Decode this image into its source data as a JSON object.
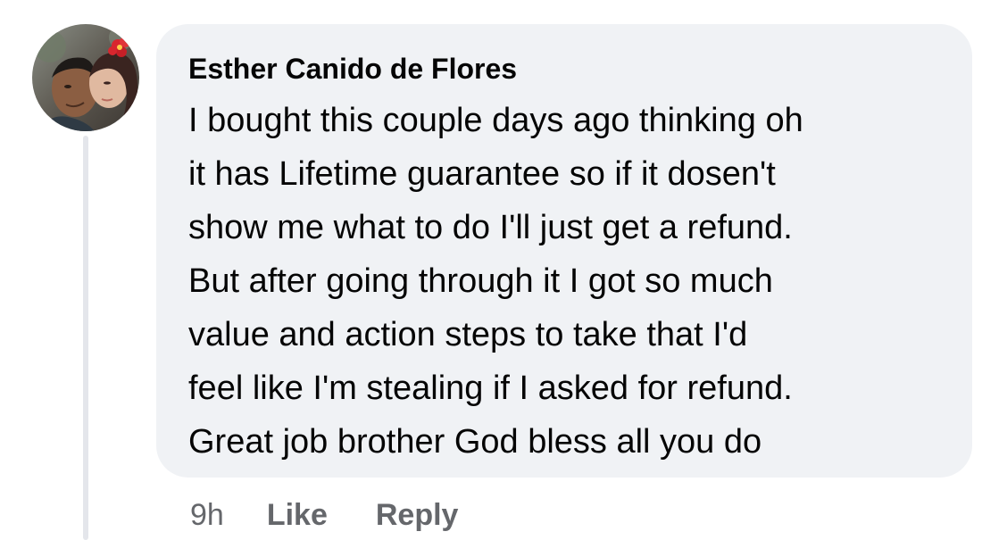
{
  "comment": {
    "author": "Esther Canido de Flores",
    "lines": [
      "I bought this couple days ago thinking oh",
      "it has Lifetime guarantee so if it dosen't",
      "show me what to do I'll just get a refund.",
      "But after going through it I got so much",
      "value and action steps to take that I'd",
      "feel like I'm stealing if I asked for refund.",
      "Great job brother God bless all you do"
    ],
    "timestamp": "9h",
    "like_label": "Like",
    "reply_label": "Reply"
  },
  "colors": {
    "bubble_background": "#f0f2f5",
    "secondary_text": "#65676b",
    "primary_text": "#050505",
    "thread_line": "#e4e6eb"
  },
  "icons": {
    "avatar": "profile-photo"
  }
}
